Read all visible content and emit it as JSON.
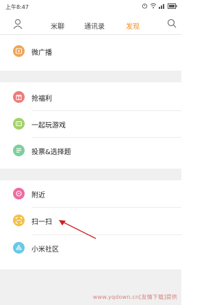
{
  "status_bar": {
    "time": "上午8:47"
  },
  "header": {
    "tabs": [
      {
        "label": "米聊"
      },
      {
        "label": "通讯录"
      },
      {
        "label": "发现",
        "active": true
      }
    ]
  },
  "sections": [
    {
      "items": [
        {
          "label": "微广播",
          "icon": "broadcast-icon",
          "color": "#f0a45a"
        }
      ]
    },
    {
      "items": [
        {
          "label": "抢福利",
          "icon": "gift-icon",
          "color": "#ee7a7a"
        },
        {
          "label": "一起玩游戏",
          "icon": "game-icon",
          "color": "#a3d16a"
        },
        {
          "label": "投票&选择题",
          "icon": "vote-icon",
          "color": "#7fcf9c"
        }
      ]
    },
    {
      "items": [
        {
          "label": "附近",
          "icon": "nearby-icon",
          "color": "#f06aa0"
        },
        {
          "label": "扫一扫",
          "icon": "scan-icon",
          "color": "#f3c04a"
        },
        {
          "label": "小米社区",
          "icon": "community-icon",
          "color": "#6ac8e6"
        }
      ]
    }
  ],
  "watermark": "www.yqdown.cn[友情下载]提供",
  "colors": {
    "accent": "#f08a1a",
    "background": "#f0f0f0",
    "annotation_arrow": "#cc2222"
  }
}
